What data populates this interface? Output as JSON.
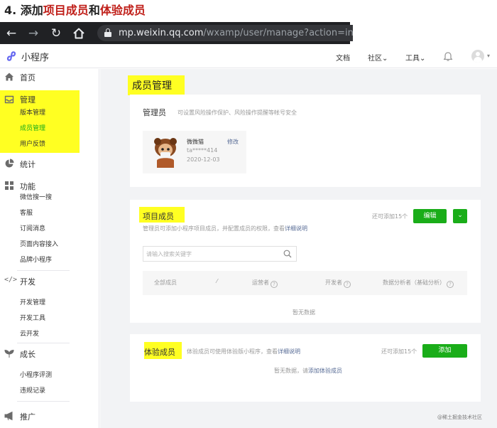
{
  "caption": {
    "prefix": "4. 添加",
    "part1": "项目成员",
    "mid": "和",
    "part2": "体验成员"
  },
  "browser": {
    "url_host": "mp.weixin.qq.com",
    "url_path": "/wxamp/user/manage?action=ind"
  },
  "header": {
    "logo_text": "小程序",
    "nav": [
      {
        "label": "文档"
      },
      {
        "label": "社区"
      },
      {
        "label": "工具"
      }
    ]
  },
  "sidebar": {
    "home": "首页",
    "manage": {
      "title": "管理",
      "items": [
        "版本管理",
        "成员管理",
        "用户反馈"
      ]
    },
    "stats": "统计",
    "features": {
      "title": "功能",
      "items": [
        "微信搜一搜",
        "客服",
        "订阅消息",
        "页面内容接入",
        "品牌小程序"
      ]
    },
    "dev": {
      "title": "开发",
      "items": [
        "开发管理",
        "开发工具",
        "云开发"
      ]
    },
    "growth": {
      "title": "成长",
      "items": [
        "小程序评测",
        "违规记录"
      ]
    },
    "promo": "推广"
  },
  "main": {
    "page_title": "成员管理",
    "admin": {
      "title": "管理员",
      "desc": "可设置风险操作保护、风险操作提醒等帐号安全",
      "name": "微微猫",
      "edit": "修改",
      "id": "ta*****414",
      "date": "2020-12-03"
    },
    "project": {
      "title": "项目成员",
      "desc": "管理员可添加小程序项目成员，并配置成员的权限，查看",
      "desc_link": "详细说明",
      "remain": "还可添加15个",
      "edit_button": "编辑",
      "search_placeholder": "请输入搜索关键字",
      "columns": [
        "全部成员",
        "运营者",
        "开发者",
        "数据分析者（基础分析）"
      ],
      "empty": "暂无数据"
    },
    "trial": {
      "title": "体验成员",
      "desc": "体验成员可使用体验版小程序，查看",
      "desc_link": "详细说明",
      "remain": "还可添加15个",
      "add_button": "添加",
      "empty_prefix": "暂无数据，请",
      "empty_link": "添加体验成员"
    }
  },
  "watermark": "@稀土掘金技术社区",
  "colors": {
    "brand_green": "#1aad19",
    "link_blue": "#576b95",
    "highlight": "#ffff22",
    "caption_red": "#c0201a"
  }
}
